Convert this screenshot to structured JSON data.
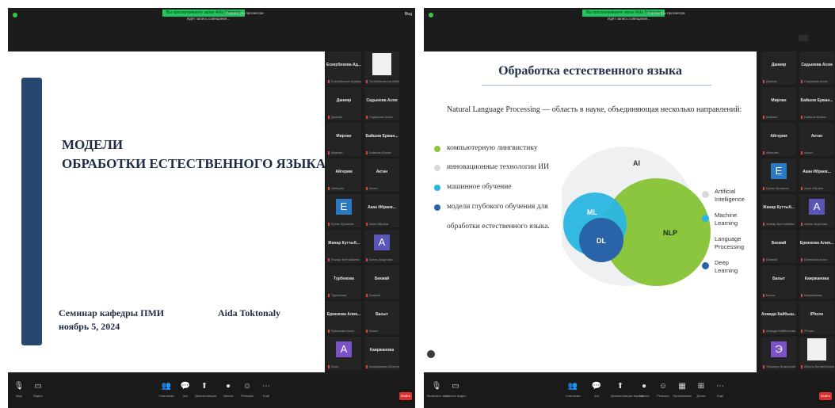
{
  "left_window": {
    "recording_pill": "Вы просматриваете экран Aida Toktonaly",
    "recording_sub": "Идёт запись совещания...",
    "view_options": "Параметры просмотра",
    "view_button": "Вид",
    "slide": {
      "title_line1": "МОДЕЛИ",
      "title_line2": "ОБРАБОТКИ ЕСТЕСТВЕННОГО ЯЗЫКА",
      "seminar": "Семинар кафедры ПМИ",
      "date": "ноябрь 5, 2024",
      "author": "Aida Toktonaly"
    },
    "participants": [
      {
        "name": "Ескербекова Ад...",
        "sub": "Ескербекова Ардашова",
        "type": "text"
      },
      {
        "name": "",
        "sub": "Толепбергенов Айбеке",
        "type": "video"
      },
      {
        "name": "Данияр",
        "sub": "Данияр",
        "type": "text"
      },
      {
        "name": "Садыкова Асем",
        "sub": "Садыкова Асем",
        "type": "text"
      },
      {
        "name": "Мирлан",
        "sub": "Мирлан",
        "type": "text"
      },
      {
        "name": "Байшов Ержан...",
        "sub": "Байшов Ержан",
        "type": "text"
      },
      {
        "name": "Айгерим",
        "sub": "Айгерим",
        "type": "text"
      },
      {
        "name": "Актан",
        "sub": "Актан",
        "type": "text"
      },
      {
        "name": "",
        "sub": "Ерлан Ерланов",
        "type": "avatar",
        "letter": "E",
        "color": "#2b79c2"
      },
      {
        "name": "Акан Ибраев...",
        "sub": "Акан Ибраев",
        "type": "text"
      },
      {
        "name": "Жанар Куттыб...",
        "sub": "Жанар Куттыбаева",
        "type": "text"
      },
      {
        "name": "",
        "sub": "Асель Аккулова",
        "type": "avatar",
        "letter": "A",
        "color": "#5a56b8"
      },
      {
        "name": "Турбекова",
        "sub": "Турбекова",
        "type": "text"
      },
      {
        "name": "Бекмай",
        "sub": "Бекмай",
        "type": "text"
      },
      {
        "name": "Ермекова Алия...",
        "sub": "Ермекова Алия",
        "type": "text"
      },
      {
        "name": "Бахыт",
        "sub": "Бахыт",
        "type": "text"
      },
      {
        "name": "",
        "sub": "Алия",
        "type": "avatar",
        "letter": "A",
        "color": "#7b52c7"
      },
      {
        "name": "Каиржанова",
        "sub": "Каиржанова Айгерим",
        "type": "text"
      }
    ],
    "toolbar": [
      {
        "icon": "🎙",
        "label": "Звук"
      },
      {
        "icon": "▭",
        "label": "Видео"
      },
      {
        "icon": "👥",
        "label": "Участники"
      },
      {
        "icon": "💬",
        "label": "Чат"
      },
      {
        "icon": "⬆",
        "label": "Демонстрация"
      },
      {
        "icon": "●",
        "label": "Запись"
      },
      {
        "icon": "☺",
        "label": "Реакции"
      },
      {
        "icon": "⋯",
        "label": "Ещё"
      }
    ],
    "end_label": "Выйти"
  },
  "right_window": {
    "recording_pill": "Вы просматриваете экран Aida Toktonaly",
    "recording_sub": "Идёт запись совещания...",
    "view_options": "Параметры просмотра",
    "slide": {
      "title": "Обработка естественного языка",
      "intro": "Natural Language Processing — область в науке, объединяющая несколько направлений:",
      "bullets": [
        {
          "text": "компьютерную лингвистику",
          "color": "#8cc63f"
        },
        {
          "text": "инновационные технологии ИИ",
          "color": "#d9d9d9"
        },
        {
          "text": "машинное обучение",
          "color": "#29b6e0"
        },
        {
          "text": "модели глубокого обучения для",
          "color": "#2a64a8"
        }
      ],
      "bullet_continuation": "обработки естественного языка.",
      "venn": {
        "ai": "AI",
        "ml": "ML",
        "dl": "DL",
        "nlp": "NLP"
      },
      "legend": [
        {
          "text": "Artificial\nIntelligence",
          "color": "#d9d9d9"
        },
        {
          "text": "Machine\nLearning",
          "color": "#29b6e0"
        },
        {
          "text": "Language\nProcessing",
          "color": "#8cc63f"
        },
        {
          "text": "Deep\nLearning",
          "color": "#2a64a8"
        }
      ]
    },
    "participants": [
      {
        "name": "Данияр",
        "sub": "Данияр",
        "type": "text"
      },
      {
        "name": "Садыкова Асем",
        "sub": "Садыкова Асем",
        "type": "text"
      },
      {
        "name": "Мирлан",
        "sub": "Мирлан",
        "type": "text"
      },
      {
        "name": "Байшов Ержан...",
        "sub": "Байшов Ержан",
        "type": "text"
      },
      {
        "name": "Айгерим",
        "sub": "Айгерим",
        "type": "text"
      },
      {
        "name": "Актан",
        "sub": "Актан",
        "type": "text"
      },
      {
        "name": "",
        "sub": "Ерлан Ерланов",
        "type": "avatar",
        "letter": "E",
        "color": "#2b79c2"
      },
      {
        "name": "Акан Ибраев...",
        "sub": "Акан Ибраев",
        "type": "text"
      },
      {
        "name": "Жанар Куттыб...",
        "sub": "Жанар Куттыбаева",
        "type": "text"
      },
      {
        "name": "",
        "sub": "Асель Аккулова",
        "type": "avatar",
        "letter": "A",
        "color": "#5a56b8"
      },
      {
        "name": "Бекмай",
        "sub": "Бекмай",
        "type": "text"
      },
      {
        "name": "Ермекова Алия...",
        "sub": "Ермекова Алия",
        "type": "text"
      },
      {
        "name": "Бахыт",
        "sub": "Бахыт",
        "type": "text"
      },
      {
        "name": "Каиржанова",
        "sub": "Каиржанова",
        "type": "text"
      },
      {
        "name": "Ахмади Кайбыш...",
        "sub": "Ахмади Кайбышева",
        "type": "text"
      },
      {
        "name": "iPhone",
        "sub": "iPhone",
        "type": "text"
      },
      {
        "name": "",
        "sub": "Эльмира Жакыпова",
        "type": "avatar",
        "letter": "Э",
        "color": "#7b52c7"
      },
      {
        "name": "",
        "sub": "Айгуль Кенжебекова",
        "type": "video"
      }
    ],
    "toolbar": [
      {
        "icon": "🎙",
        "label": "Включить звук"
      },
      {
        "icon": "▭",
        "label": "Начать видео"
      },
      {
        "icon": "👥",
        "label": "Участники"
      },
      {
        "icon": "💬",
        "label": "Чат"
      },
      {
        "icon": "⬆",
        "label": "Демонстрация экрана"
      },
      {
        "icon": "●",
        "label": "Запись"
      },
      {
        "icon": "☺",
        "label": "Реакции"
      },
      {
        "icon": "▦",
        "label": "Приложения"
      },
      {
        "icon": "⊞",
        "label": "Доски"
      },
      {
        "icon": "⋯",
        "label": "Ещё"
      }
    ],
    "end_label": "Выйти"
  }
}
